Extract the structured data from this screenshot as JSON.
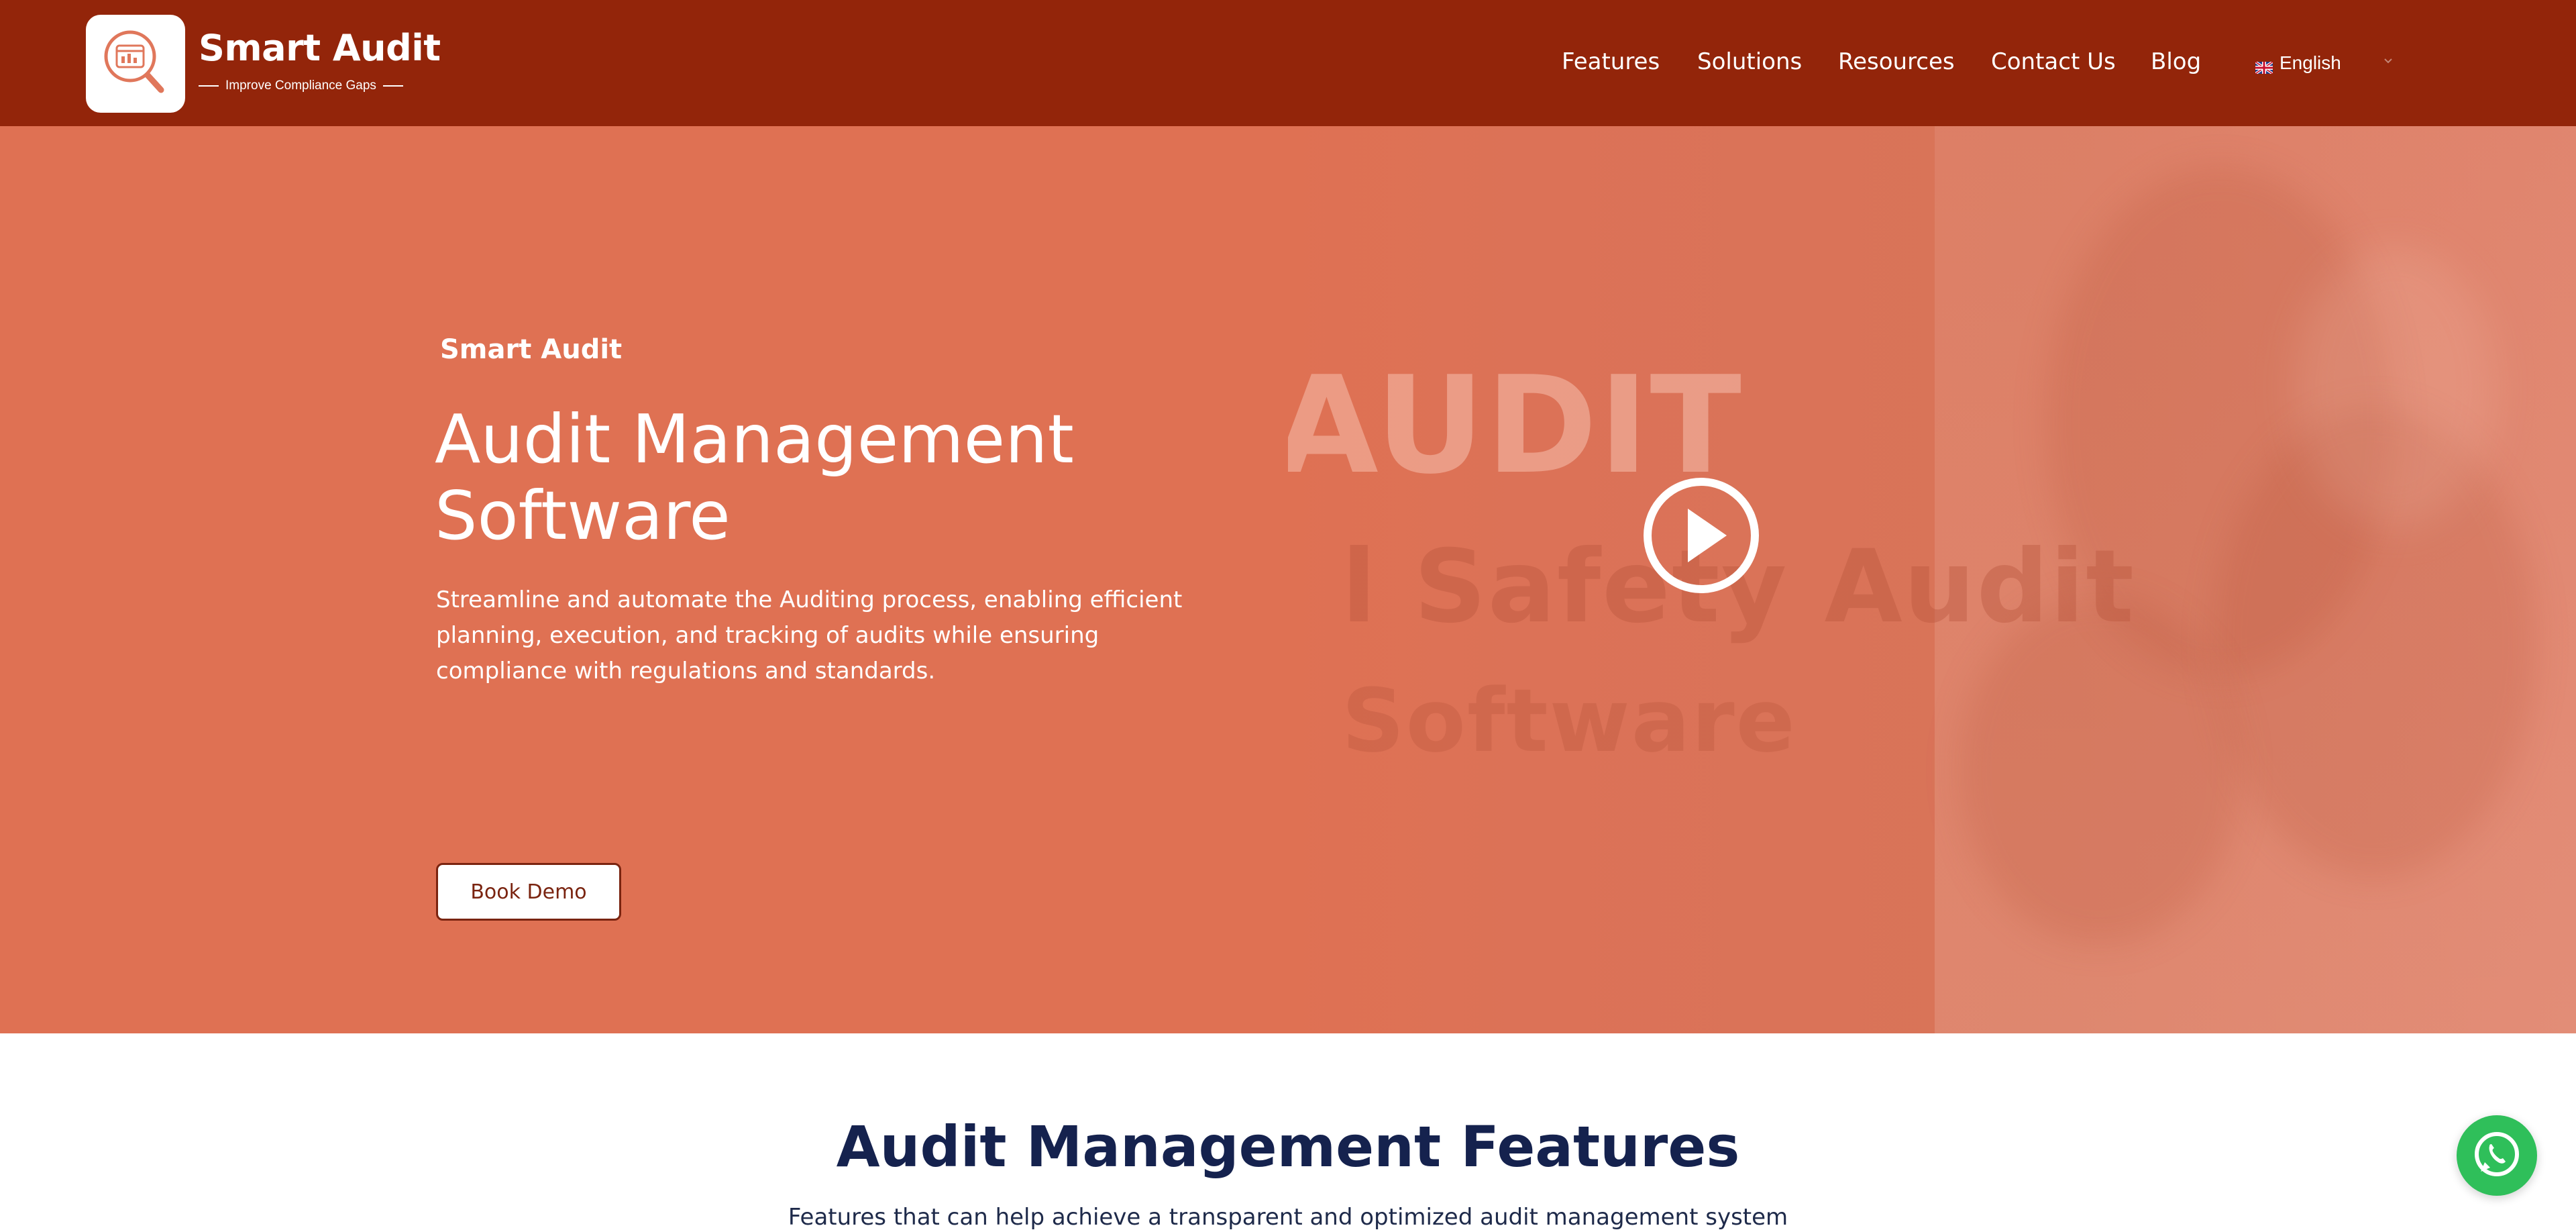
{
  "brand": {
    "name": "Smart Audit",
    "tagline": "Improve Compliance Gaps"
  },
  "nav": {
    "items": [
      {
        "label": "Features"
      },
      {
        "label": "Solutions"
      },
      {
        "label": "Resources"
      },
      {
        "label": "Contact Us"
      },
      {
        "label": "Blog"
      }
    ],
    "language": "English"
  },
  "hero": {
    "eyebrow": "Smart Audit",
    "title": "Audit Management Software",
    "description": "Streamline and automate the Auditing process, enabling efficient planning, execution, and tracking of audits while ensuring compliance with regulations and standards.",
    "cta_label": "Book Demo",
    "video_text": [
      "AUDIT",
      "l Safety Audit",
      "Software"
    ]
  },
  "features": {
    "title": "Audit Management Features",
    "subtitle": "Features that can help achieve a transparent and optimized audit management system"
  },
  "colors": {
    "header_bg": "#93250a",
    "hero_bg": "#df7153",
    "heading_navy": "#15224e",
    "whatsapp_green": "#2fbf5a"
  },
  "icons": {
    "logo": "audit-magnifier-icon",
    "play": "play-icon",
    "whatsapp": "whatsapp-icon",
    "flag": "uk-flag-icon",
    "caret": "chevron-down-icon"
  }
}
